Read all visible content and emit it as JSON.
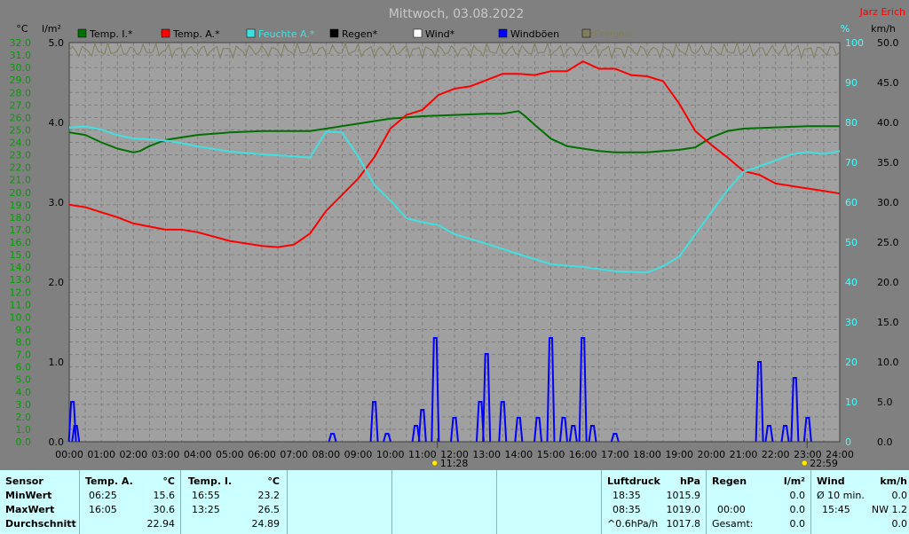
{
  "header": {
    "title": "Mittwoch, 03.08.2022",
    "station": "Jarz Erich"
  },
  "colors": {
    "plot_bg": "#a0a0a0",
    "grid": "#808080",
    "temp_i": "#007000",
    "temp_a": "#ff0000",
    "humidity": "#40e0e0",
    "rain": "#000000",
    "wind": "#ffffff",
    "gust": "#0000ff",
    "radiation": "#7f7f5a",
    "axis_text_left": "#00a000",
    "axis_text_right": "#40ffff",
    "title": "#c8c8c8",
    "panel_bg": "#ccffff"
  },
  "axes": {
    "temp_unit": "°C",
    "rain_unit": "l/m²",
    "hum_unit": "%",
    "wind_unit": "km/h",
    "temp_ticks": [
      "32.0",
      "31.0",
      "30.0",
      "29.0",
      "28.0",
      "27.0",
      "26.0",
      "25.0",
      "24.0",
      "23.0",
      "22.0",
      "21.0",
      "20.0",
      "19.0",
      "18.0",
      "17.0",
      "16.0",
      "15.0",
      "14.0",
      "13.0",
      "12.0",
      "11.0",
      "10.0",
      "9.0",
      "8.0",
      "7.0",
      "6.0",
      "5.0",
      "4.0",
      "3.0",
      "2.0",
      "1.0",
      "0.0"
    ],
    "rain_ticks": [
      "5.0",
      "4.0",
      "3.0",
      "2.0",
      "1.0",
      "0.0"
    ],
    "hum_ticks": [
      "100",
      "90",
      "80",
      "70",
      "60",
      "50",
      "40",
      "30",
      "20",
      "10",
      "0"
    ],
    "wind_ticks": [
      "50.0",
      "45.0",
      "40.0",
      "35.0",
      "30.0",
      "25.0",
      "20.0",
      "15.0",
      "10.0",
      "5.0",
      "0.0"
    ],
    "hour_ticks": [
      "00:00",
      "01:00",
      "02:00",
      "03:00",
      "04:00",
      "05:00",
      "06:00",
      "07:00",
      "08:00",
      "09:00",
      "10:00",
      "11:00",
      "12:00",
      "13:00",
      "14:00",
      "15:00",
      "16:00",
      "17:00",
      "18:00",
      "19:00",
      "20:00",
      "21:00",
      "22:00",
      "23:00",
      "24:00"
    ],
    "markers": [
      "11:28",
      "22:59"
    ]
  },
  "chart_data": {
    "type": "line",
    "title": "Mittwoch, 03.08.2022",
    "x_unit": "hour",
    "xlim": [
      0,
      24
    ],
    "ylim_temp": [
      0,
      32
    ],
    "ylim_rain": [
      0,
      5
    ],
    "ylim_humidity": [
      0,
      100
    ],
    "ylim_wind": [
      0,
      50
    ],
    "grid": true,
    "legend_position": "top",
    "legend": [
      "Temp. I.*",
      "Temp. A.*",
      "Feuchte A.*",
      "Regen*",
      "Wind*",
      "Windböen",
      "Ereignis"
    ],
    "series": [
      {
        "name": "Temp. I.*",
        "axis": "temp",
        "x": [
          0,
          0.5,
          1,
          1.5,
          2,
          2.2,
          2.5,
          3,
          3.5,
          4,
          5,
          6,
          7,
          7.5,
          8,
          9,
          10,
          11,
          12,
          13,
          13.5,
          14,
          14.2,
          14.5,
          15,
          15.5,
          16,
          16.5,
          17,
          17.5,
          18,
          18.5,
          19,
          19.5,
          20,
          20.5,
          21,
          22,
          23,
          24
        ],
        "y": [
          24.8,
          24.6,
          24.0,
          23.5,
          23.2,
          23.3,
          23.7,
          24.2,
          24.4,
          24.6,
          24.8,
          24.9,
          24.9,
          24.9,
          25.1,
          25.5,
          25.9,
          26.1,
          26.2,
          26.3,
          26.3,
          26.5,
          26.1,
          25.4,
          24.3,
          23.7,
          23.5,
          23.3,
          23.2,
          23.2,
          23.2,
          23.3,
          23.4,
          23.6,
          24.4,
          24.9,
          25.1,
          25.2,
          25.3,
          25.3
        ]
      },
      {
        "name": "Temp. A.*",
        "axis": "temp",
        "x": [
          0,
          0.5,
          1,
          1.5,
          2,
          3,
          3.5,
          4,
          5,
          6,
          6.5,
          7,
          7.5,
          8,
          8.5,
          9,
          9.5,
          10,
          10.5,
          11,
          11.5,
          12,
          12.5,
          13,
          13.5,
          14,
          14.5,
          15,
          15.5,
          16,
          16.5,
          17,
          17.5,
          18,
          18.5,
          19,
          19.5,
          20,
          20.5,
          21,
          21.5,
          22,
          22.5,
          23,
          23.5,
          24
        ],
        "y": [
          19,
          18.8,
          18.4,
          18,
          17.5,
          17,
          17,
          16.8,
          16.1,
          15.7,
          15.6,
          15.8,
          16.7,
          18.5,
          19.8,
          21.1,
          22.8,
          25.1,
          26.2,
          26.6,
          27.8,
          28.3,
          28.5,
          29.0,
          29.5,
          29.5,
          29.4,
          29.7,
          29.7,
          30.5,
          29.9,
          29.9,
          29.4,
          29.3,
          28.9,
          27.1,
          24.9,
          23.8,
          22.8,
          21.7,
          21.4,
          20.7,
          20.5,
          20.3,
          20.1,
          19.9
        ]
      },
      {
        "name": "Feuchte A.*",
        "axis": "humidity",
        "x": [
          0,
          0.5,
          1,
          1.5,
          2,
          3,
          3.5,
          4,
          5,
          6,
          7,
          7.5,
          8,
          8.5,
          9,
          9.5,
          10,
          10.5,
          11,
          11.5,
          12,
          13,
          14,
          15,
          15.5,
          16,
          17,
          18,
          18.5,
          19,
          19.5,
          20,
          20.5,
          21,
          21.5,
          22,
          22.5,
          23,
          23.5,
          24
        ],
        "y": [
          78.7,
          79.0,
          78.2,
          76.8,
          76,
          75.5,
          74.8,
          74,
          72.7,
          72,
          71.5,
          71.2,
          77.7,
          77.5,
          71.5,
          64.3,
          60.5,
          56,
          55,
          54.3,
          52,
          49.6,
          47,
          44.5,
          44.1,
          43.8,
          42.7,
          42.4,
          44,
          46.4,
          52,
          57.5,
          63,
          67.6,
          69,
          70.5,
          72,
          72.6,
          72.1,
          72.8
        ]
      },
      {
        "name": "Windböen",
        "axis": "wind",
        "style": "spikes",
        "x": [
          0.1,
          0.2,
          8.2,
          9.5,
          9.9,
          10.4,
          10.8,
          11.0,
          11.4,
          12.0,
          12.8,
          13.0,
          13.5,
          14.0,
          14.6,
          15.0,
          15.4,
          15.7,
          16.0,
          16.3,
          17.0,
          18.2,
          19.3,
          20.0,
          21.0,
          21.5,
          21.8,
          22.3,
          22.6,
          23.0
        ],
        "y": [
          5,
          2,
          1,
          5,
          1,
          0,
          2,
          4,
          13,
          3,
          5,
          11,
          5,
          3,
          3,
          13,
          3,
          2,
          13,
          2,
          1,
          0,
          0,
          0,
          0,
          10,
          2,
          2,
          8,
          3
        ]
      },
      {
        "name": "Ereignis",
        "axis": "humidity",
        "style": "flat-noise",
        "x": [
          0,
          24
        ],
        "y": [
          99,
          99
        ]
      }
    ]
  },
  "panels": {
    "labels": {
      "title": "Sensor",
      "min": "MinWert",
      "max": "MaxWert",
      "avg": "Durchschnitt"
    },
    "temp_a": {
      "name": "Temp. A.",
      "unit": "°C",
      "min_time": "06:25",
      "min_val": "15.6",
      "max_time": "16:05",
      "max_val": "30.6",
      "avg": "22.94"
    },
    "temp_i": {
      "name": "Temp. I.",
      "unit": "°C",
      "min_time": "16:55",
      "min_val": "23.2",
      "max_time": "13:25",
      "max_val": "26.5",
      "avg": "24.89"
    },
    "pressure": {
      "name": "Luftdruck",
      "unit": "hPa",
      "r1_time": "18:35",
      "r1_val": "1015.9",
      "r2_time": "08:35",
      "r2_val": "1019.0",
      "r3_label": "^0.6hPa/h",
      "r3_val": "1017.8"
    },
    "rain": {
      "name": "Regen",
      "unit": "l/m²",
      "r2_time": "00:00",
      "r2_val": "0.0",
      "r3_label": "Gesamt:",
      "r3_val": "0.0",
      "r1_val": "0.0"
    },
    "wind": {
      "name": "Wind",
      "unit": "km/h",
      "r1_label": "Ø 10 min.",
      "r1_val": "0.0",
      "r2_time": "15:45",
      "r2_val": "NW 1.2",
      "r3_val": "0.0"
    }
  }
}
